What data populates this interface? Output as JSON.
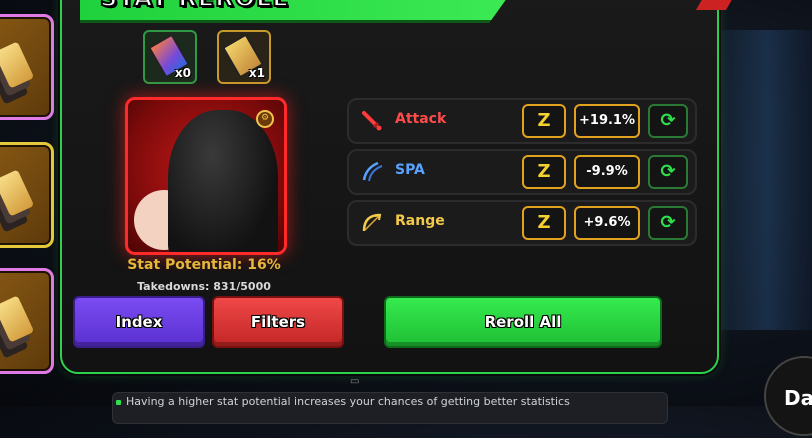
{
  "title": "STAT REROLL",
  "tickets": [
    {
      "count": "x0",
      "icon": "reroll-ticket-icon"
    },
    {
      "count": "x1",
      "icon": "gold-reroll-ticket-icon"
    }
  ],
  "unit": {
    "stat_potential": "Stat Potential: 16%",
    "takedowns": "Takedowns: 831/5000"
  },
  "stats": [
    {
      "name": "Attack",
      "grade": "Z",
      "value": "+19.1%",
      "color": "#ff4a4a",
      "icon": "sword-icon"
    },
    {
      "name": "SPA",
      "grade": "Z",
      "value": "-9.9%",
      "color": "#5aa2ff",
      "icon": "speed-icon"
    },
    {
      "name": "Range",
      "grade": "Z",
      "value": "+9.6%",
      "color": "#f2c94a",
      "icon": "bow-icon"
    }
  ],
  "buttons": {
    "index": "Index",
    "filters": "Filters",
    "reroll_all": "Reroll All"
  },
  "tip": "Having a higher stat potential increases your chances of getting better statistics",
  "side_button": "Da"
}
